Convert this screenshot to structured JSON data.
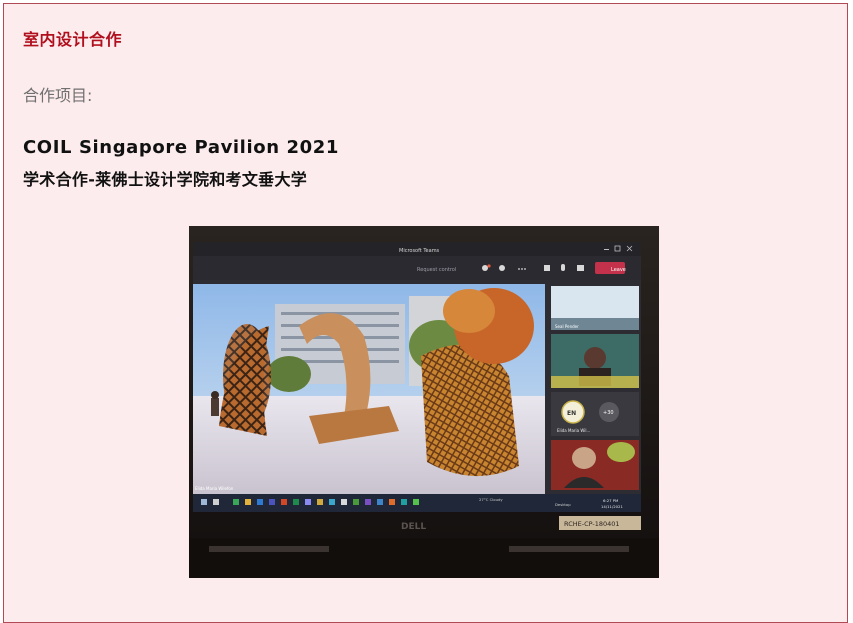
{
  "section": {
    "heading": "室内设计合作",
    "project_label": "合作项目:",
    "project_title": "COIL Singapore Pavilion 2021",
    "project_subtitle": "学术合作-莱佛士设计学院和考文垂大学"
  },
  "photo": {
    "window_title": "Microsoft Teams",
    "request_control": "Request control",
    "leave_button": "Leave",
    "participant_1": "Seal Pender",
    "participant_initials": "EN",
    "participant_name_2": "Elida Maria Wil...",
    "more_participants": "+30",
    "presenter_name": "Elida Maria Wilefon",
    "laptop_brand": "DELL",
    "asset_tag": "RCHE-CP-180401",
    "taskbar_weather": "27°C Cloudy",
    "taskbar_time": "6:27 PM",
    "taskbar_date": "14/11/2021",
    "taskbar_desktop": "Desktop"
  }
}
